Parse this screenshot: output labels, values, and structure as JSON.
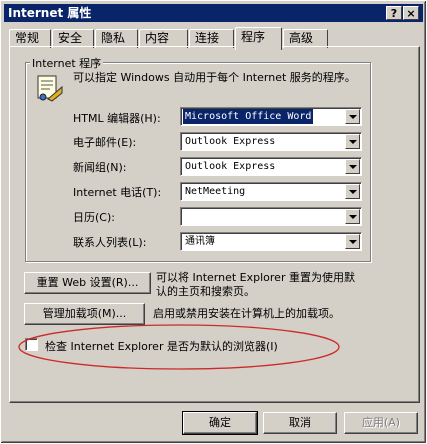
{
  "window": {
    "title": "Internet 属性",
    "help_glyph": "?",
    "close_glyph": "×"
  },
  "tabs": [
    {
      "label": "常规"
    },
    {
      "label": "安全"
    },
    {
      "label": "隐私"
    },
    {
      "label": "内容"
    },
    {
      "label": "连接"
    },
    {
      "label": "程序",
      "active": true
    },
    {
      "label": "高级"
    }
  ],
  "programs": {
    "group_title": "Internet 程序",
    "description_line1": "可以指定 Windows 自动用于每个 Internet 服务的程序。",
    "rows": [
      {
        "label": "HTML 编辑器(H):",
        "value": "Microsoft Office Word"
      },
      {
        "label": "电子邮件(E):",
        "value": "Outlook Express"
      },
      {
        "label": "新闻组(N):",
        "value": "Outlook Express"
      },
      {
        "label": "Internet 电话(T):",
        "value": "NetMeeting"
      },
      {
        "label": "日历(C):",
        "value": ""
      },
      {
        "label": "联系人列表(L):",
        "value": "通讯簿"
      }
    ]
  },
  "reset_web": {
    "button_label": "重置 Web 设置(R)...",
    "description_line1": "可以将 Internet Explorer 重置为使用默",
    "description_line2": "认的主页和搜索页。"
  },
  "addons": {
    "button_label": "管理加载项(M)...",
    "description": "启用或禁用安装在计算机上的加载项。"
  },
  "default_check": {
    "label": "检查 Internet Explorer 是否为默认的浏览器(I)",
    "checked": false
  },
  "footer": {
    "ok_label": "确定",
    "cancel_label": "取消",
    "apply_label": "应用(A)"
  },
  "colors": {
    "titlebar": "#0a246a",
    "face": "#d4d0c8",
    "annotation": "#cc2a2a"
  }
}
